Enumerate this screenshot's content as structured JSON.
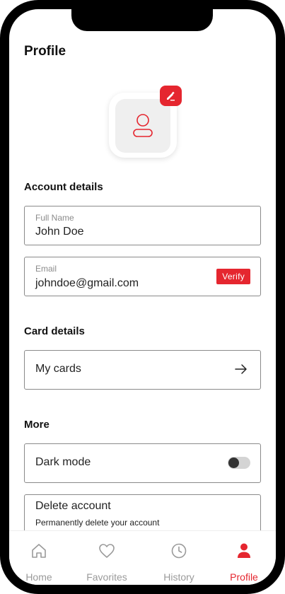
{
  "page": {
    "title": "Profile"
  },
  "icons": {
    "avatar": "user-outline-icon",
    "edit": "pencil-icon",
    "arrow": "arrow-right-icon"
  },
  "colors": {
    "accent": "#e5262f",
    "border": "#8a8a8a"
  },
  "sections": {
    "account": {
      "title": "Account details",
      "full_name": {
        "label": "Full Name",
        "value": "John Doe"
      },
      "email": {
        "label": "Email",
        "value": "johndoe@gmail.com",
        "verify_label": "Verify"
      }
    },
    "card": {
      "title": "Card details",
      "my_cards_label": "My cards"
    },
    "more": {
      "title": "More",
      "dark_mode_label": "Dark mode",
      "dark_mode_on": false,
      "delete_label": "Delete account",
      "delete_sub": "Permanently delete your account"
    }
  },
  "tabbar": {
    "tabs": [
      {
        "label": "Home",
        "icon": "home-icon",
        "active": false
      },
      {
        "label": "Favorites",
        "icon": "heart-icon",
        "active": false
      },
      {
        "label": "History",
        "icon": "clock-icon",
        "active": false
      },
      {
        "label": "Profile",
        "icon": "user-icon",
        "active": true
      }
    ]
  }
}
